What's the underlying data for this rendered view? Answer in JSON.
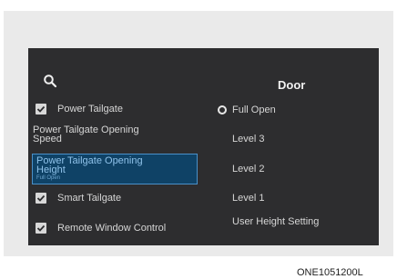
{
  "settings": {
    "search_icon": "search-icon",
    "menu": [
      {
        "label": "Power Tailgate",
        "checked": true
      },
      {
        "label": "Power Tailgate Opening Speed"
      },
      {
        "label": "Power Tailgate Opening Height",
        "sub": "Full Open",
        "selected": true
      },
      {
        "label": "Smart Tailgate",
        "checked": true
      },
      {
        "label": "Remote Window Control",
        "checked": true
      }
    ],
    "panel": {
      "title": "Door",
      "options": [
        "Full Open",
        "Level 3",
        "Level 2",
        "Level 1",
        "User Height Setting"
      ],
      "selected_option": "Full Open"
    }
  },
  "caption": "ONE1051200L",
  "colors": {
    "screen_bg": "#2d2d2f",
    "highlight": "#0f4266",
    "highlight_border": "#4a90c8"
  }
}
